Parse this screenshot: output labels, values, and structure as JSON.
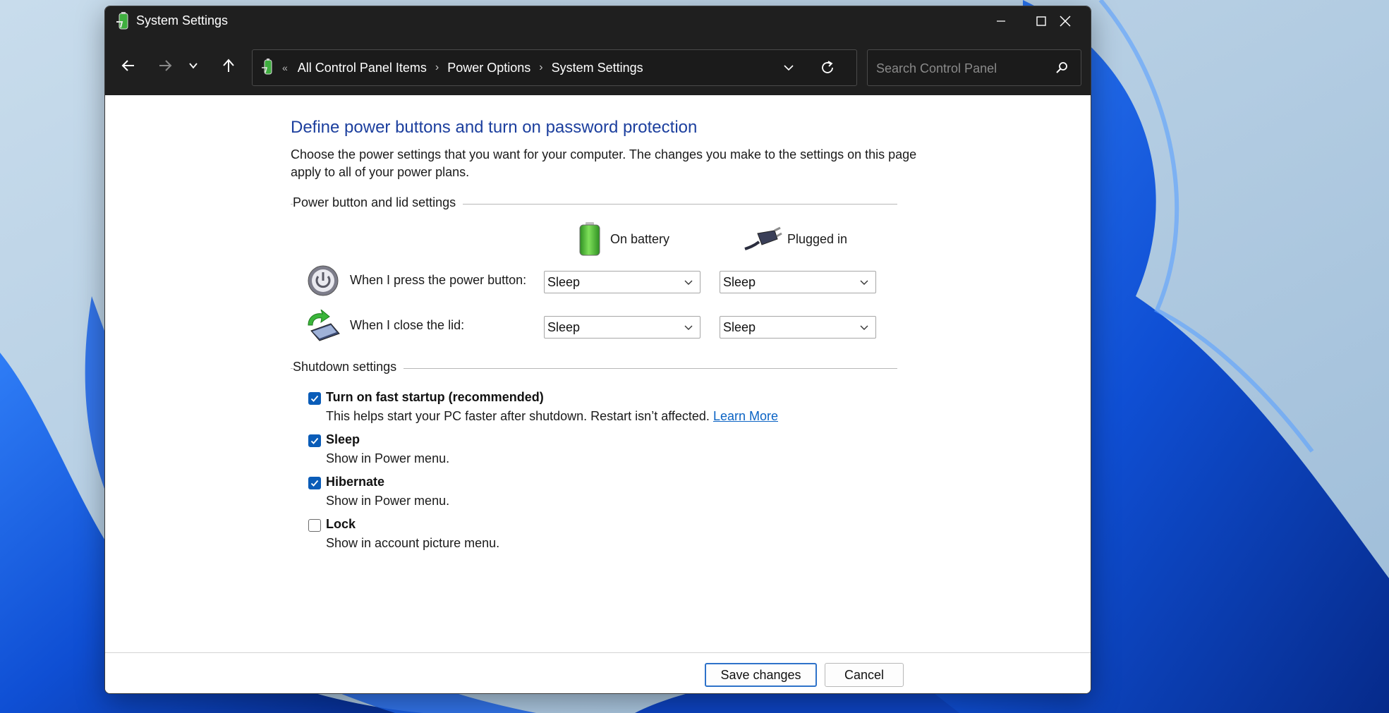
{
  "window": {
    "title": "System Settings"
  },
  "nav": {
    "address": {
      "overflow": "«",
      "crumbs": [
        "All Control Panel Items",
        "Power Options",
        "System Settings"
      ]
    },
    "search_placeholder": "Search Control Panel"
  },
  "page": {
    "heading": "Define power buttons and turn on password protection",
    "description": "Choose the power settings that you want for your computer. The changes you make to the settings on this page apply to all of your power plans."
  },
  "power_section": {
    "label": "Power button and lid settings",
    "columns": {
      "battery": "On battery",
      "plugged": "Plugged in"
    },
    "rows": [
      {
        "label": "When I press the power button:",
        "battery": "Sleep",
        "plugged": "Sleep"
      },
      {
        "label": "When I close the lid:",
        "battery": "Sleep",
        "plugged": "Sleep"
      }
    ]
  },
  "shutdown_section": {
    "label": "Shutdown settings",
    "options": [
      {
        "title": "Turn on fast startup (recommended)",
        "desc": "This helps start your PC faster after shutdown. Restart isn’t affected.",
        "link": "Learn More",
        "checked": true
      },
      {
        "title": "Sleep",
        "desc": "Show in Power menu.",
        "checked": true
      },
      {
        "title": "Hibernate",
        "desc": "Show in Power menu.",
        "checked": true
      },
      {
        "title": "Lock",
        "desc": "Show in account picture menu.",
        "checked": false
      }
    ]
  },
  "footer": {
    "save": "Save changes",
    "cancel": "Cancel"
  },
  "colors": {
    "accent": "#0a5cb8",
    "heading": "#1c3f9e",
    "link": "#0b63c4",
    "titlebar": "#1f1f1f"
  },
  "icons": [
    "battery-icon",
    "plug-icon",
    "power-icon",
    "laptop-lid-icon",
    "back-arrow-icon",
    "forward-arrow-icon",
    "recent-chevron-icon",
    "up-arrow-icon",
    "refresh-icon",
    "search-icon",
    "minimize-icon",
    "maximize-icon",
    "close-icon"
  ]
}
